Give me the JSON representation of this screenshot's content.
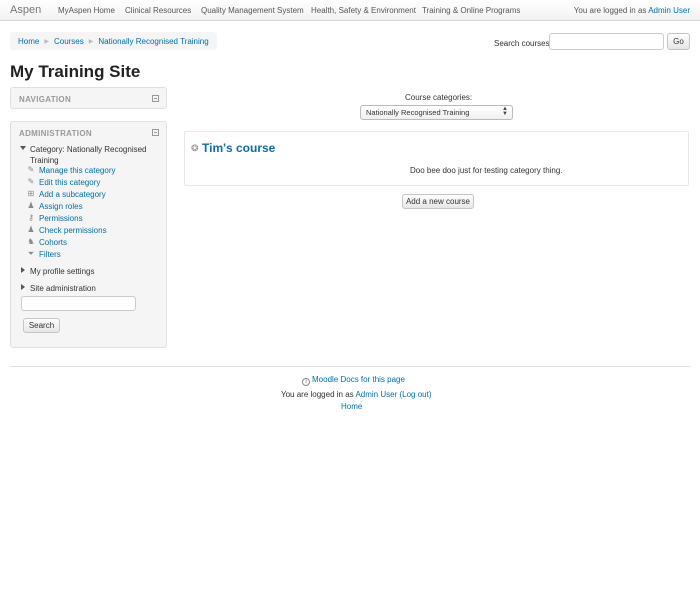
{
  "navbar": {
    "brand": "Aspen",
    "items": [
      "MyAspen Home",
      "Clinical Resources",
      "Quality Management System",
      "Health, Safety & Environment",
      "Training & Online Programs"
    ],
    "login_prefix": "You are logged in as",
    "user": "Admin User"
  },
  "breadcrumb": [
    "Home",
    "Courses",
    "Nationally Recognised Training"
  ],
  "search": {
    "label": "Search courses:",
    "value": "",
    "button": "Go"
  },
  "page_title": "My Training Site",
  "navigation_block": {
    "title": "NAVIGATION"
  },
  "admin_block": {
    "title": "ADMINISTRATION",
    "category_label": "Category: Nationally Recognised Training",
    "links": [
      {
        "label": "Manage this category",
        "icon": "pencil-icon"
      },
      {
        "label": "Edit this category",
        "icon": "pencil-icon"
      },
      {
        "label": "Add a subcategory",
        "icon": "add-icon"
      },
      {
        "label": "Assign roles",
        "icon": "user-icon"
      },
      {
        "label": "Permissions",
        "icon": "key-icon"
      },
      {
        "label": "Check permissions",
        "icon": "user-check-icon"
      },
      {
        "label": "Cohorts",
        "icon": "cohort-icon"
      },
      {
        "label": "Filters",
        "icon": "filter-icon"
      }
    ],
    "profile_settings": "My profile settings",
    "site_administration": "Site administration",
    "search_value": "",
    "search_button": "Search"
  },
  "main": {
    "categories_label": "Course categories:",
    "selected_category": "Nationally Recognised Training",
    "course": {
      "name": "Tim's course",
      "summary": "Doo bee doo just for testing category thing."
    },
    "add_course_button": "Add a new course"
  },
  "footer": {
    "docs_link": "Moodle Docs for this page",
    "login_prefix": "You are logged in as",
    "user": "Admin User",
    "logout": "(Log out)",
    "home": "Home"
  }
}
